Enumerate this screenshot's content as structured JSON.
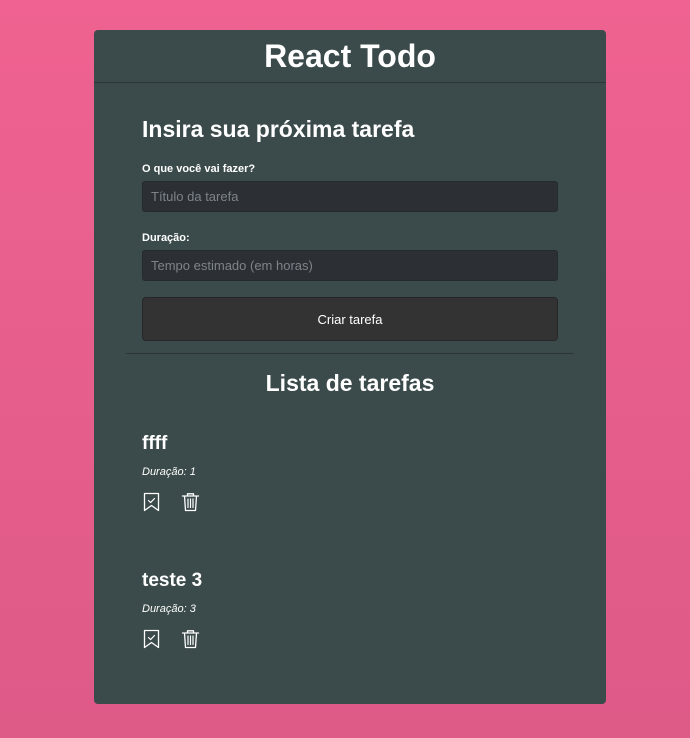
{
  "header": {
    "title": "React Todo"
  },
  "form": {
    "heading": "Insira sua próxima tarefa",
    "title_label": "O que você vai fazer?",
    "title_placeholder": "Título da tarefa",
    "title_value": "",
    "duration_label": "Duração:",
    "duration_placeholder": "Tempo estimado (em horas)",
    "duration_value": "",
    "submit_label": "Criar tarefa"
  },
  "list": {
    "heading": "Lista de tarefas",
    "tasks": [
      {
        "title": "ffff",
        "duration": "Duração: 1",
        "action_icons": [
          "bookmark-check-icon",
          "trash-icon"
        ]
      },
      {
        "title": "teste 3",
        "duration": "Duração: 3",
        "action_icons": [
          "bookmark-check-icon",
          "trash-icon"
        ]
      }
    ]
  },
  "colors": {
    "background": "#ef6291",
    "card": "#3b4a4a",
    "input": "#2c3035",
    "button": "#333333",
    "text": "#ffffff"
  }
}
